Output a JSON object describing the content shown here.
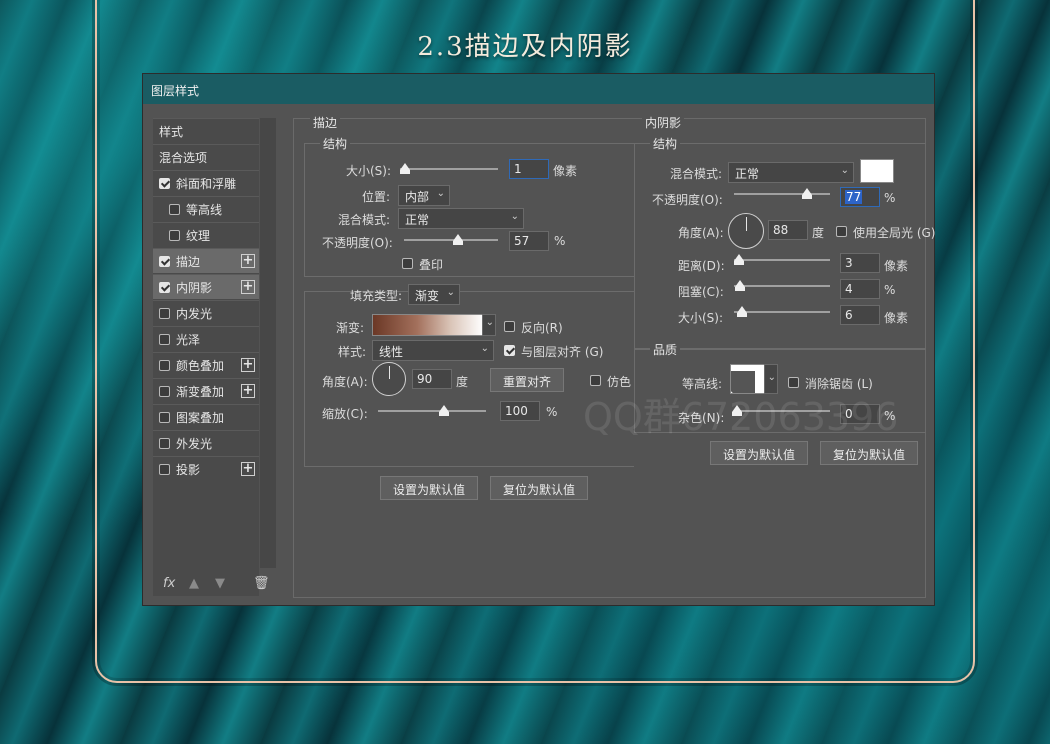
{
  "page_title": "2.3描边及内阴影",
  "watermark": "QQ群672063396",
  "dialog": {
    "title": "图层样式",
    "sidebar": {
      "items": [
        {
          "label": "样式",
          "checkbox": false,
          "checked": false,
          "plus": false
        },
        {
          "label": "混合选项",
          "checkbox": false,
          "checked": false,
          "plus": false
        },
        {
          "label": "斜面和浮雕",
          "checkbox": true,
          "checked": true,
          "plus": false
        },
        {
          "label": "等高线",
          "checkbox": true,
          "checked": false,
          "plus": false
        },
        {
          "label": "纹理",
          "checkbox": true,
          "checked": false,
          "plus": false
        },
        {
          "label": "描边",
          "checkbox": true,
          "checked": true,
          "plus": true
        },
        {
          "label": "内阴影",
          "checkbox": true,
          "checked": true,
          "plus": true
        },
        {
          "label": "内发光",
          "checkbox": true,
          "checked": false,
          "plus": false
        },
        {
          "label": "光泽",
          "checkbox": true,
          "checked": false,
          "plus": false
        },
        {
          "label": "颜色叠加",
          "checkbox": true,
          "checked": false,
          "plus": true
        },
        {
          "label": "渐变叠加",
          "checkbox": true,
          "checked": false,
          "plus": true
        },
        {
          "label": "图案叠加",
          "checkbox": true,
          "checked": false,
          "plus": false
        },
        {
          "label": "外发光",
          "checkbox": true,
          "checked": false,
          "plus": false
        },
        {
          "label": "投影",
          "checkbox": true,
          "checked": false,
          "plus": true
        }
      ],
      "footer_fx": "fx"
    },
    "stroke": {
      "section_title": "描边",
      "structure_title": "结构",
      "size_label": "大小(S):",
      "size_value": "1",
      "size_unit": "像素",
      "position_label": "位置:",
      "position_value": "内部",
      "blend_label": "混合模式:",
      "blend_value": "正常",
      "opacity_label": "不透明度(O):",
      "opacity_value": "57",
      "opacity_unit": "%",
      "overprint_label": "叠印",
      "fill_type_label": "填充类型:",
      "fill_type_value": "渐变",
      "gradient_label": "渐变:",
      "reverse_label": "反向(R)",
      "style_label": "样式:",
      "style_value": "线性",
      "align_label": "与图层对齐 (G)",
      "angle_label": "角度(A):",
      "angle_value": "90",
      "angle_unit": "度",
      "reset_align_label": "重置对齐",
      "dither_label": "仿色",
      "scale_label": "缩放(C):",
      "scale_value": "100",
      "scale_unit": "%",
      "default_button": "设置为默认值",
      "reset_button": "复位为默认值"
    },
    "inner_shadow": {
      "section_title": "内阴影",
      "structure_title": "结构",
      "blend_label": "混合模式:",
      "blend_value": "正常",
      "opacity_label": "不透明度(O):",
      "opacity_value": "77",
      "opacity_unit": "%",
      "angle_label": "角度(A):",
      "angle_value": "88",
      "angle_unit": "度",
      "global_light_label": "使用全局光 (G)",
      "distance_label": "距离(D):",
      "distance_value": "3",
      "distance_unit": "像素",
      "choke_label": "阻塞(C):",
      "choke_value": "4",
      "choke_unit": "%",
      "size_label": "大小(S):",
      "size_value": "6",
      "size_unit": "像素",
      "quality_title": "品质",
      "contour_label": "等高线:",
      "antialias_label": "消除锯齿 (L)",
      "noise_label": "杂色(N):",
      "noise_value": "0",
      "noise_unit": "%",
      "default_button": "设置为默认值",
      "reset_button": "复位为默认值"
    }
  }
}
